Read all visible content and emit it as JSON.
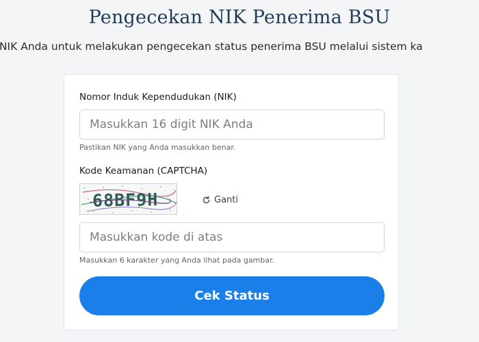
{
  "page": {
    "title": "Pengecekan NIK Penerima BSU",
    "subtitle": "kan NIK Anda untuk melakukan pengecekan status penerima BSU melalui sistem ka"
  },
  "form": {
    "nik_label": "Nomor Induk Kependudukan (NIK)",
    "nik_placeholder": "Masukkan 16 digit NIK Anda",
    "nik_hint": "Pastikan NIK yang Anda masukkan benar.",
    "captcha_label": "Kode Keamanan (CAPTCHA)",
    "captcha_text": "68BF9H",
    "refresh_label": "Ganti",
    "refresh_icon": "refresh-icon",
    "captcha_placeholder": "Masukkan kode di atas",
    "captcha_hint": "Masukkan 6 karakter yang Anda lihat pada gambar.",
    "submit_label": "Cek Status"
  },
  "colors": {
    "accent": "#1a7fe8",
    "title": "#1f3b57",
    "background": "#f4f5f7"
  }
}
